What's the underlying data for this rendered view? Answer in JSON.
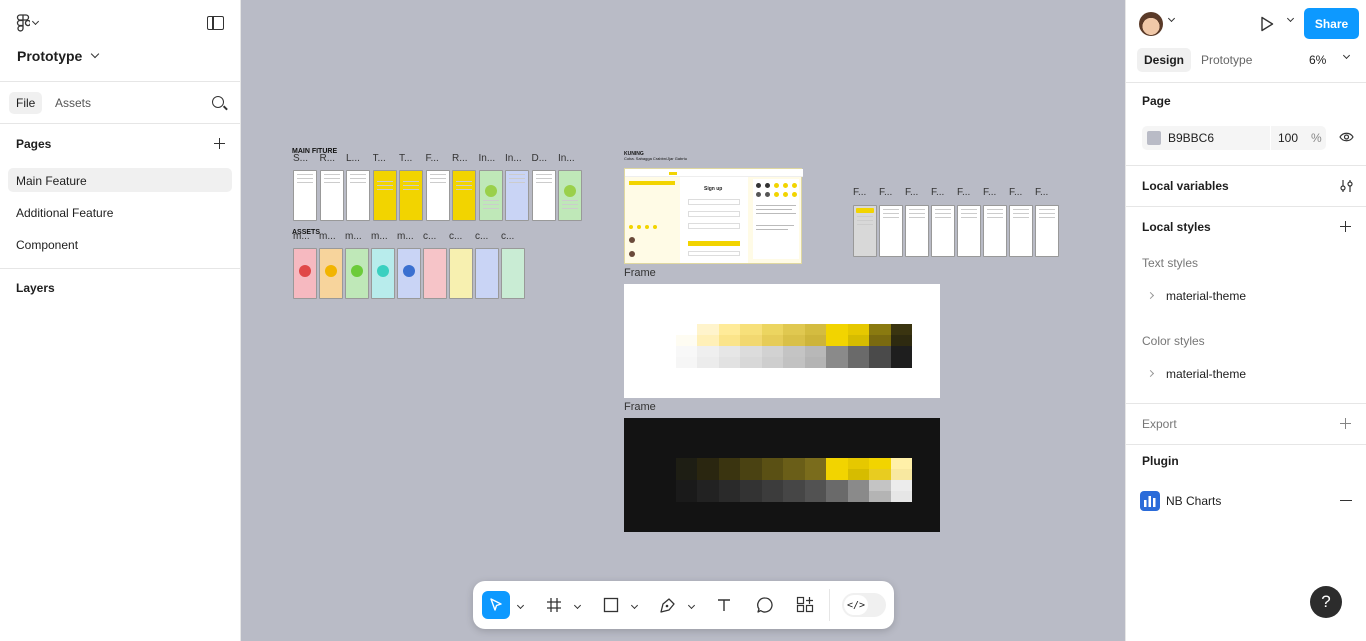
{
  "left_panel": {
    "project_name": "Prototype",
    "tabs": [
      "File",
      "Assets"
    ],
    "pages_heading": "Pages",
    "pages": [
      "Main Feature",
      "Additional Feature",
      "Component"
    ],
    "layers_heading": "Layers"
  },
  "canvas": {
    "background": "#B9BBC6",
    "group_main_title": "MAIN FITURE",
    "main_row_labels": [
      "S...",
      "R...",
      "L...",
      "T...",
      "T...",
      "F...",
      "R...",
      "In...",
      "In...",
      "D...",
      "In..."
    ],
    "group_assets_title": "ASSETS",
    "assets_row_labels": [
      "m...",
      "m...",
      "m...",
      "m...",
      "m...",
      "c...",
      "c...",
      "c...",
      "c..."
    ],
    "kuning_title": "KUNING",
    "kuning_subtitle": "Coba. Sahagga Crabbn/Jjar Gabrtu",
    "right_row_labels": [
      "F...",
      "F...",
      "F...",
      "F...",
      "F...",
      "F...",
      "F...",
      "F..."
    ],
    "frame1_label": "Frame",
    "frame2_label": "Frame",
    "signup_title": "Sign up"
  },
  "right_panel": {
    "share_label": "Share",
    "tabs": [
      "Design",
      "Prototype"
    ],
    "zoom": "6%",
    "page_heading": "Page",
    "page_color": "B9BBC6",
    "page_opacity": "100",
    "opacity_unit": "%",
    "local_variables": "Local variables",
    "local_styles": "Local styles",
    "text_styles_label": "Text styles",
    "text_style_item": "material-theme",
    "color_styles_label": "Color styles",
    "color_style_item": "material-theme",
    "export_label": "Export",
    "plugin_label": "Plugin",
    "plugin_item": "NB Charts",
    "help": "?"
  },
  "colors": {
    "accent": "#0D99FF",
    "yellow": "#F2D400"
  }
}
